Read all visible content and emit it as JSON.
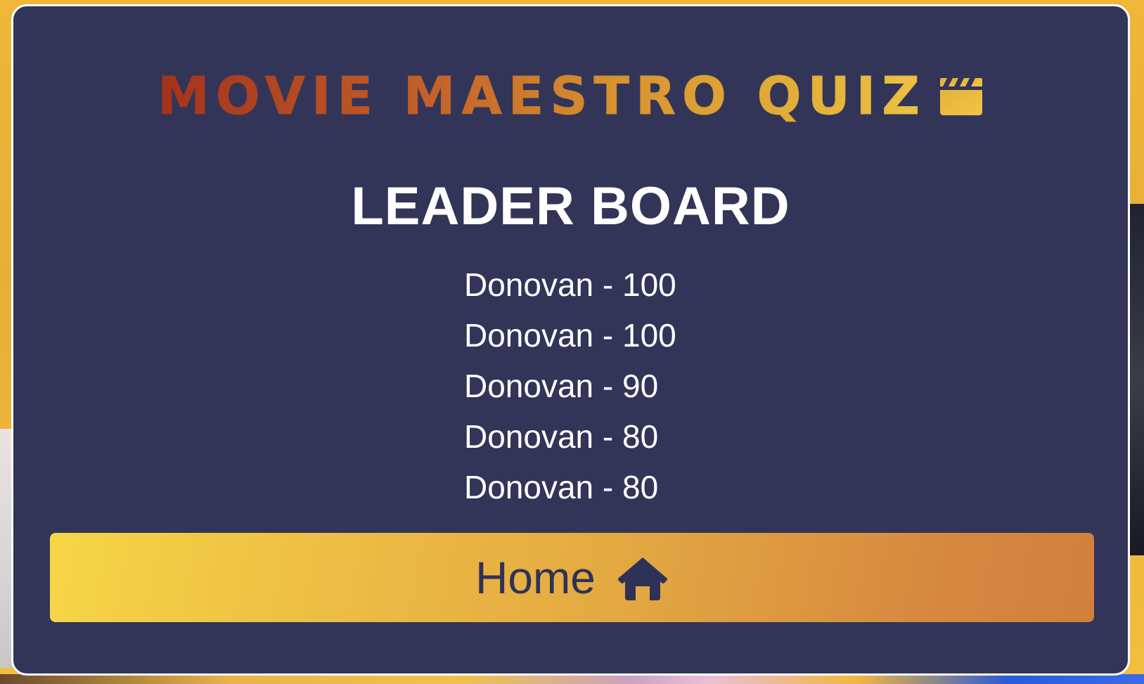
{
  "app": {
    "title": "MOVIE MAESTRO QUIZ"
  },
  "icons": {
    "title_icon": "clapperboard-icon",
    "home_icon": "home-icon"
  },
  "leaderboard": {
    "heading": "LEADER BOARD",
    "entries": [
      "Donovan - 100",
      "Donovan - 100",
      "Donovan - 90",
      "Donovan - 80",
      "Donovan - 80"
    ]
  },
  "home_button": {
    "label": "Home"
  },
  "colors": {
    "card_background": "#323558",
    "card_border": "#ffffff",
    "heading_text": "#ffffff",
    "title_gradient_start": "#a3321c",
    "title_gradient_end": "#edc342",
    "button_gradient_start": "#f6d647",
    "button_gradient_end": "#d17f3e",
    "button_text": "#2f3258"
  }
}
